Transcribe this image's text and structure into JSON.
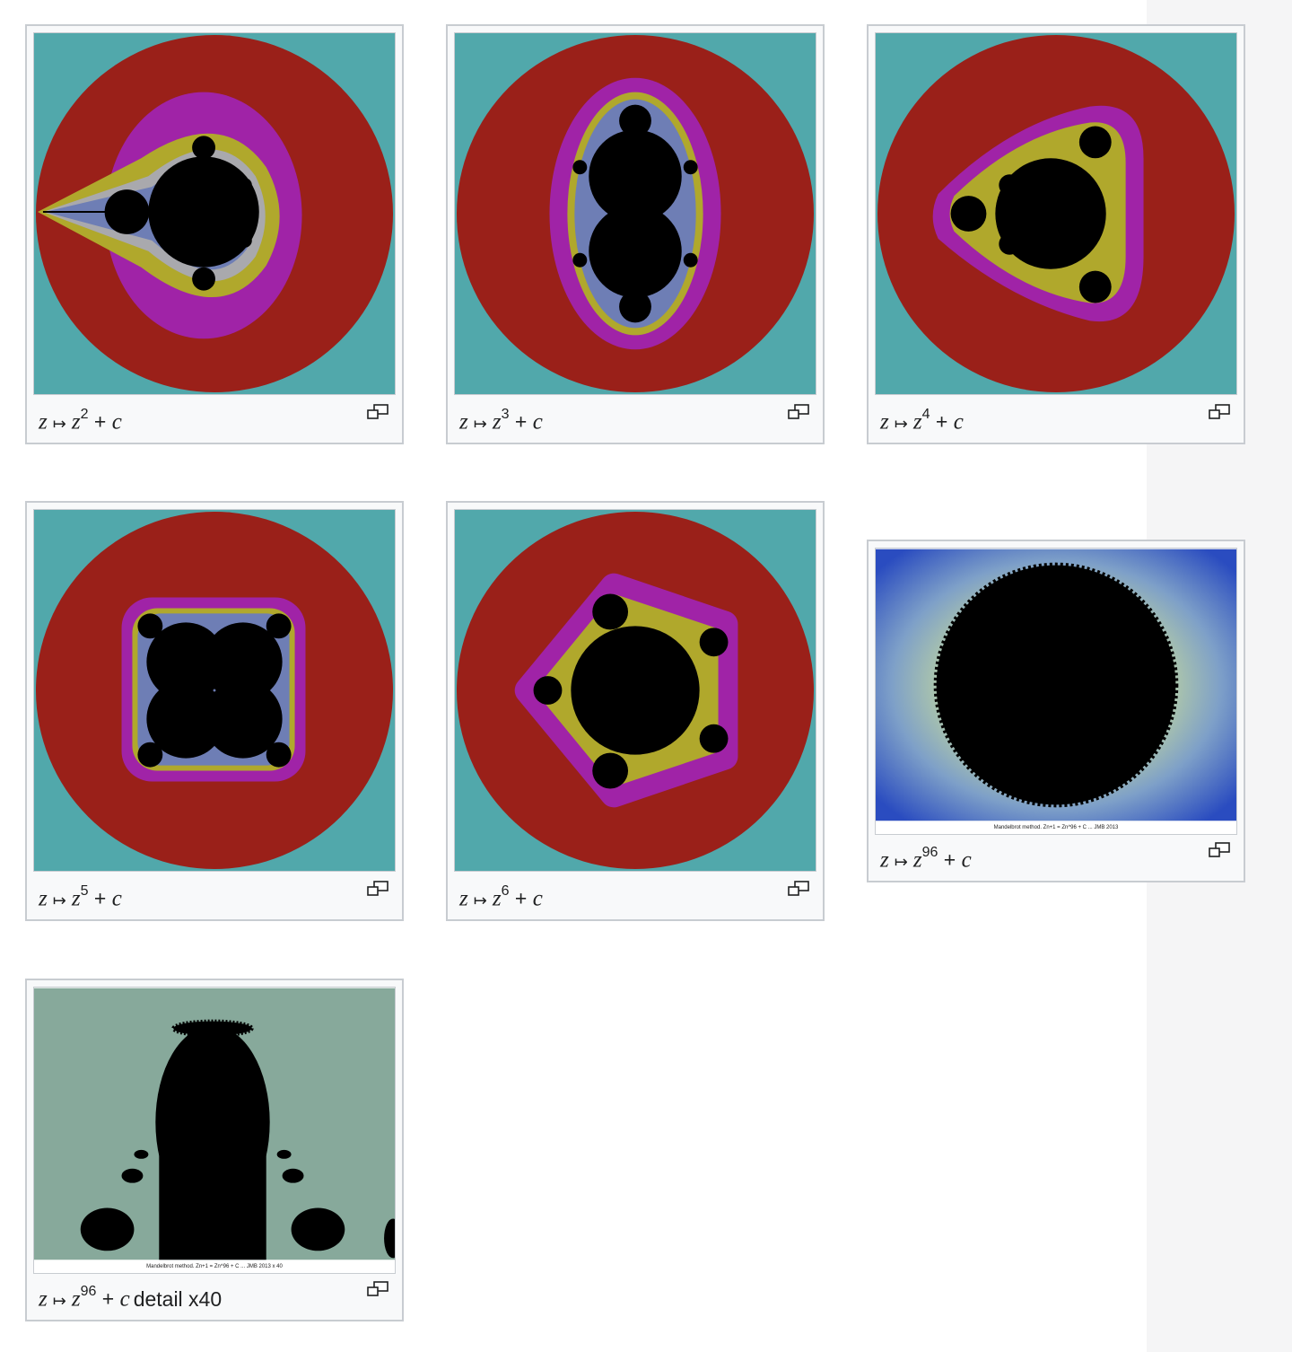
{
  "gallery": {
    "items": [
      {
        "id": "d2",
        "var_z": "z",
        "maps": "↦",
        "base": "z",
        "exponent": "2",
        "plus": "+",
        "var_c": "c",
        "suffix": "",
        "enlarge_icon": "enlarge-icon"
      },
      {
        "id": "d3",
        "var_z": "z",
        "maps": "↦",
        "base": "z",
        "exponent": "3",
        "plus": "+",
        "var_c": "c",
        "suffix": "",
        "enlarge_icon": "enlarge-icon"
      },
      {
        "id": "d4",
        "var_z": "z",
        "maps": "↦",
        "base": "z",
        "exponent": "4",
        "plus": "+",
        "var_c": "c",
        "suffix": "",
        "enlarge_icon": "enlarge-icon"
      },
      {
        "id": "d5",
        "var_z": "z",
        "maps": "↦",
        "base": "z",
        "exponent": "5",
        "plus": "+",
        "var_c": "c",
        "suffix": "",
        "enlarge_icon": "enlarge-icon"
      },
      {
        "id": "d6",
        "var_z": "z",
        "maps": "↦",
        "base": "z",
        "exponent": "6",
        "plus": "+",
        "var_c": "c",
        "suffix": "",
        "enlarge_icon": "enlarge-icon"
      },
      {
        "id": "d96",
        "var_z": "z",
        "maps": "↦",
        "base": "z",
        "exponent": "96",
        "plus": "+",
        "var_c": "c",
        "suffix": "",
        "credit": "Mandelbrot method.  Zn+1 =  Zn^96 + C   ...  JMB 2013",
        "enlarge_icon": "enlarge-icon"
      },
      {
        "id": "d96d",
        "var_z": "z",
        "maps": "↦",
        "base": "z",
        "exponent": "96",
        "plus": "+",
        "var_c": "c",
        "suffix": "detail x40",
        "credit": "Mandelbrot method.  Zn+1 =  Zn^96 + C   ...  JMB 2013   x 40",
        "enlarge_icon": "enlarge-icon"
      }
    ]
  },
  "colors": {
    "teal_background": "#51a8ab",
    "escape_red": "#9a2019",
    "escape_magenta": "#a023a7",
    "escape_olive": "#b0a82c",
    "set_black": "#000000",
    "border": "#c8ccd1",
    "caption_bg": "#f8f9fa",
    "rail_bg": "#f5f5f6"
  }
}
